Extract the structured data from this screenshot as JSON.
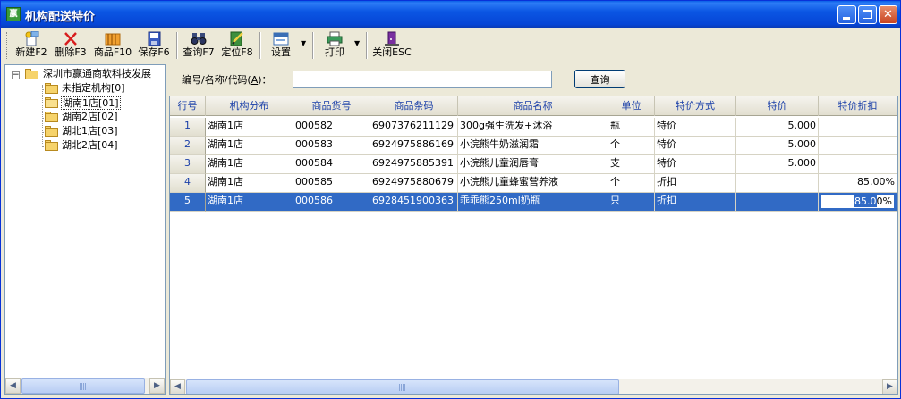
{
  "window": {
    "title": "机构配送特价",
    "icon_label": "赢"
  },
  "toolbar": {
    "new_label": "新建F2",
    "delete_label": "删除F3",
    "goods_label": "商品F10",
    "save_label": "保存F6",
    "query_label": "查询F7",
    "locate_label": "定位F8",
    "settings_label": "设置",
    "print_label": "打印",
    "close_label": "关闭ESC"
  },
  "tree": {
    "root": "深圳市赢通商软科技发展",
    "items": [
      "未指定机构[0]",
      "湖南1店[01]",
      "湖南2店[02]",
      "湖北1店[03]",
      "湖北2店[04]"
    ]
  },
  "search": {
    "label_prefix": "编号/名称/代码(",
    "label_key": "A",
    "label_suffix": ")：",
    "value": "",
    "button_label": "查询"
  },
  "grid": {
    "columns": [
      "行号",
      "机构分布",
      "商品货号",
      "商品条码",
      "商品名称",
      "单位",
      "特价方式",
      "特价",
      "特价折扣"
    ],
    "rows": [
      [
        "1",
        "湖南1店",
        "000582",
        "6907376211129",
        "300g强生洗发+沐浴",
        "瓶",
        "特价",
        "5.000",
        ""
      ],
      [
        "2",
        "湖南1店",
        "000583",
        "6924975886169",
        "小浣熊牛奶滋润霜",
        "个",
        "特价",
        "5.000",
        ""
      ],
      [
        "3",
        "湖南1店",
        "000584",
        "6924975885391",
        "小浣熊儿童润唇膏",
        "支",
        "特价",
        "5.000",
        ""
      ],
      [
        "4",
        "湖南1店",
        "000585",
        "6924975880679",
        "小浣熊儿童蜂蜜营养液",
        "个",
        "折扣",
        "",
        "85.00%"
      ],
      [
        "5",
        "湖南1店",
        "000586",
        "6928451900363",
        "乖乖熊250ml奶瓶",
        "只",
        "折扣",
        "",
        ""
      ]
    ],
    "editing_value": "85.0",
    "editing_suffix": "0%"
  }
}
